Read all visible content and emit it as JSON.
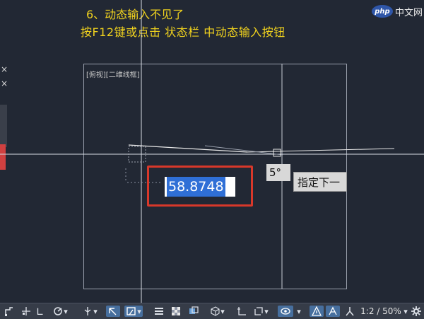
{
  "tutorial": {
    "title": "6、动态输入不见了",
    "instruction": "按F12键或点击  状态栏  中动态输入按钮"
  },
  "watermark": {
    "logo": "php",
    "text": "中文网"
  },
  "side_panel": {
    "close_1": "×",
    "close_2": "×"
  },
  "viewport": {
    "label": "[俯视][二维线框]"
  },
  "dynamic_input": {
    "value": "58.8748"
  },
  "angle_tip": {
    "value": "5°"
  },
  "prompt_tip": {
    "text": "指定下一"
  },
  "statusbar": {
    "zoom": "1:2 / 50%",
    "icons": [
      "snap-icon",
      "grid-snap-icon",
      "ortho-icon",
      "polar-icon",
      "object-snap-icon",
      "dynamic-ucs-icon",
      "lineweight-icon",
      "transparency-icon",
      "selection-cycling-icon",
      "3d-osnap-icon",
      "annotation-icon",
      "workspace-icon",
      "isolate-icon",
      "annotation-scale-icon",
      "settings-icon"
    ]
  },
  "colors": {
    "background": "#222834",
    "instruction": "#f0d21e",
    "highlight": "#d8382a",
    "selection": "#2f6fd6"
  }
}
